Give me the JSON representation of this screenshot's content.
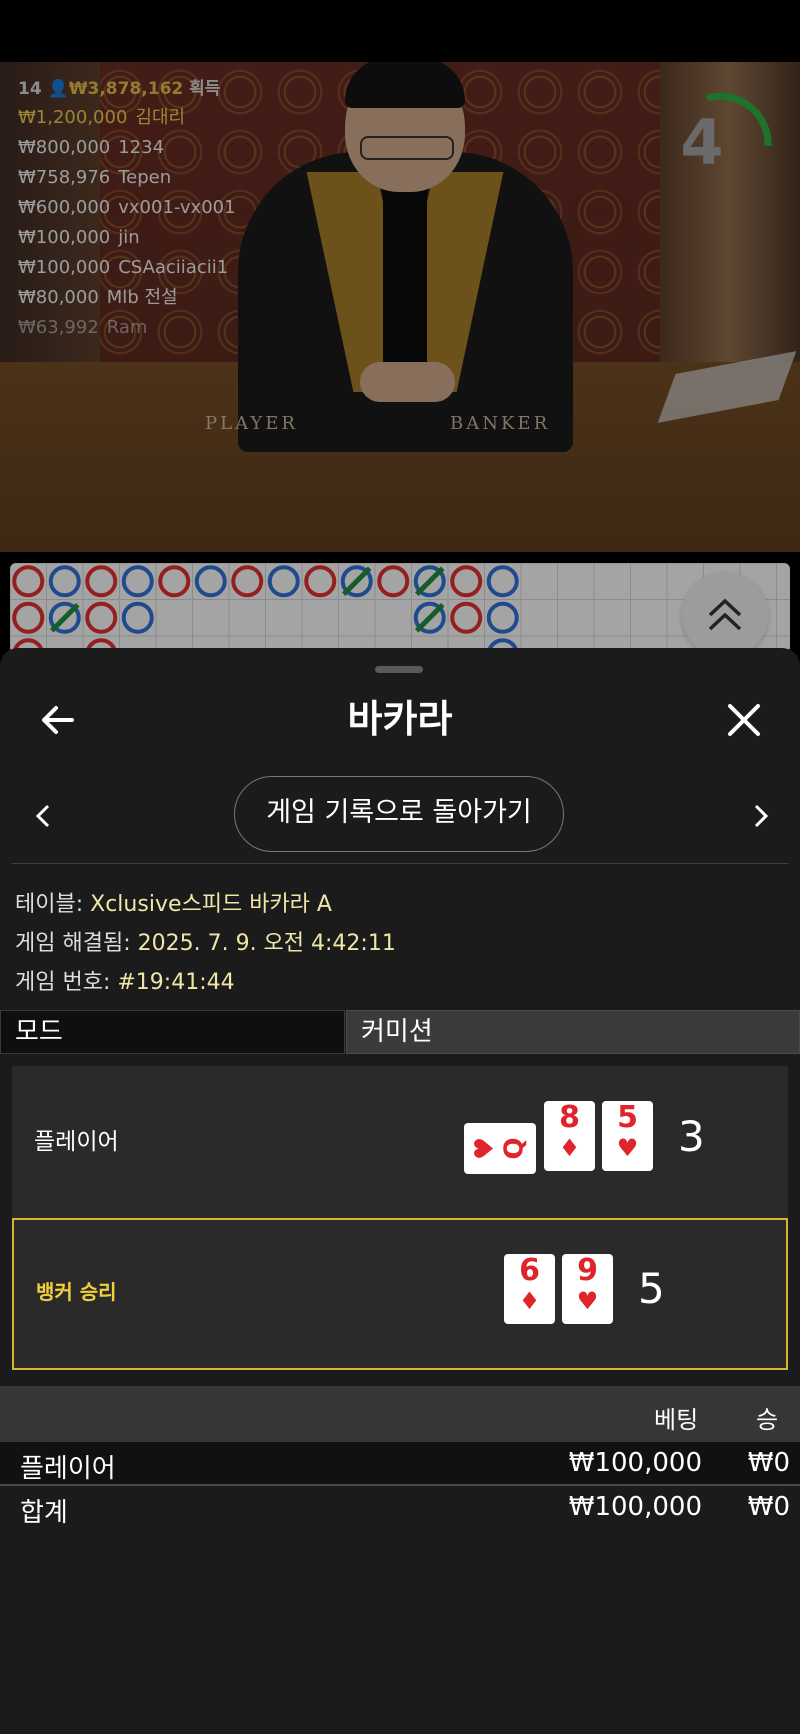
{
  "video": {
    "countdown": "4",
    "table_labels": {
      "player": "PLAYER",
      "banker": "BANKER"
    }
  },
  "leaderboard": {
    "players_count": "14",
    "total_amount": "₩3,878,162",
    "total_suffix": "획득",
    "rows": [
      {
        "amount": "₩1,200,000",
        "name": "김대리"
      },
      {
        "amount": "₩800,000",
        "name": "1234"
      },
      {
        "amount": "₩758,976",
        "name": "Tepen"
      },
      {
        "amount": "₩600,000",
        "name": "vx001-vx001"
      },
      {
        "amount": "₩100,000",
        "name": "jin"
      },
      {
        "amount": "₩100,000",
        "name": "CSAaciiacii1"
      },
      {
        "amount": "₩80,000",
        "name": "Mlb 전설"
      },
      {
        "amount": "₩63,992",
        "name": "Ram"
      }
    ]
  },
  "bead_road": {
    "row1": [
      "B",
      "P",
      "B",
      "P",
      "B",
      "P",
      "B",
      "P",
      "B",
      "T",
      "B",
      "T",
      "B",
      "P"
    ],
    "row2": [
      "B",
      "T",
      "B",
      "P",
      "",
      "",
      "",
      "",
      "",
      "",
      "",
      "T",
      "B",
      "P"
    ]
  },
  "colors": {
    "banker": "#d9302e",
    "player": "#2f6fd0",
    "tie": "#1f8a3a",
    "accent": "#d8b42e"
  },
  "panel": {
    "title": "바카라",
    "back_to_history": "게임 기록으로 돌아가기",
    "info": {
      "table_label": "테이블:",
      "table_value": "Xclusive스피드 바카라 A",
      "resolved_label": "게임 해결됨:",
      "resolved_value": "2025. 7. 9. 오전 4:42:11",
      "game_no_label": "게임 번호:",
      "game_no_value": "#19:41:44"
    },
    "tabs": {
      "mode": "모드",
      "commission": "커미션"
    },
    "result": {
      "player": {
        "label": "플레이어",
        "score": "3",
        "cards": [
          {
            "rank": "Q",
            "suit": "♥"
          },
          {
            "rank": "8",
            "suit": "♦"
          },
          {
            "rank": "5",
            "suit": "♥"
          }
        ]
      },
      "banker": {
        "label": "뱅커 승리",
        "score": "5",
        "cards": [
          {
            "rank": "6",
            "suit": "♦"
          },
          {
            "rank": "9",
            "suit": "♥"
          }
        ]
      }
    },
    "bets": {
      "col_bet": "베팅",
      "col_win": "승",
      "rows": [
        {
          "name": "플레이어",
          "bet": "₩100,000",
          "win": "₩0"
        },
        {
          "name": "합계",
          "bet": "₩100,000",
          "win": "₩0"
        }
      ]
    }
  }
}
